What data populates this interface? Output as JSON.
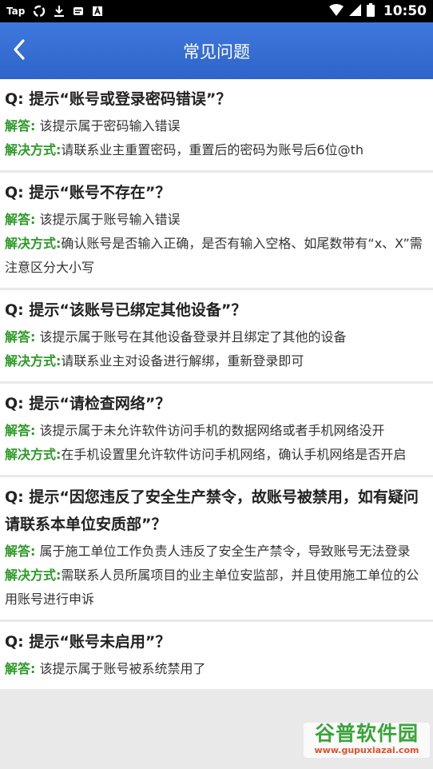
{
  "status_bar": {
    "left_items": [
      {
        "icon": "tap-text",
        "label": "Tap"
      },
      {
        "icon": "sync-icon"
      },
      {
        "icon": "download-icon"
      },
      {
        "icon": "message-icon"
      },
      {
        "icon": "a-box-icon"
      }
    ],
    "time": "10:50",
    "right_icons": [
      "wifi-icon",
      "signal-icon",
      "battery-icon"
    ]
  },
  "header": {
    "title": "常见问题",
    "back_icon": "chevron-left-icon"
  },
  "faqs": [
    {
      "q": "Q: 提示“账号或登录密码错误”？",
      "answer_label": "解答:",
      "answer": "该提示属于密码输入错误",
      "solution_label": "解决方式:",
      "solution": "请联系业主重置密码，重置后的密码为账号后6位@th"
    },
    {
      "q": "Q: 提示“账号不存在”？",
      "answer_label": "解答:",
      "answer": "该提示属于账号输入错误",
      "solution_label": "解决方式:",
      "solution": "确认账号是否输入正确，是否有输入空格、如尾数带有“x、X”需注意区分大小写"
    },
    {
      "q": "Q: 提示“该账号已绑定其他设备”？",
      "answer_label": "解答:",
      "answer": "该提示属于账号在其他设备登录并且绑定了其他的设备",
      "solution_label": "解决方式:",
      "solution": "请联系业主对设备进行解绑，重新登录即可"
    },
    {
      "q": "Q: 提示“请检查网络”？",
      "answer_label": "解答:",
      "answer": "该提示属于未允许软件访问手机的数据网络或者手机网络没开",
      "solution_label": "解决方式:",
      "solution": "在手机设置里允许软件访问手机网络，确认手机网络是否开启"
    },
    {
      "q": "Q: 提示“因您违反了安全生产禁令，故账号被禁用，如有疑问请联系本单位安质部”？",
      "answer_label": "解答:",
      "answer": "属于施工单位工作负责人违反了安全生产禁令，导致账号无法登录",
      "solution_label": "解决方式:",
      "solution": "需联系人员所属项目的业主单位安监部，并且使用施工单位的公用账号进行申诉"
    },
    {
      "q": "Q: 提示“账号未启用”？",
      "answer_label": "解答:",
      "answer": "该提示属于账号被系统禁用了"
    }
  ],
  "watermark": {
    "name": "谷普软件园",
    "url": "www.gupuxiazai.com"
  }
}
